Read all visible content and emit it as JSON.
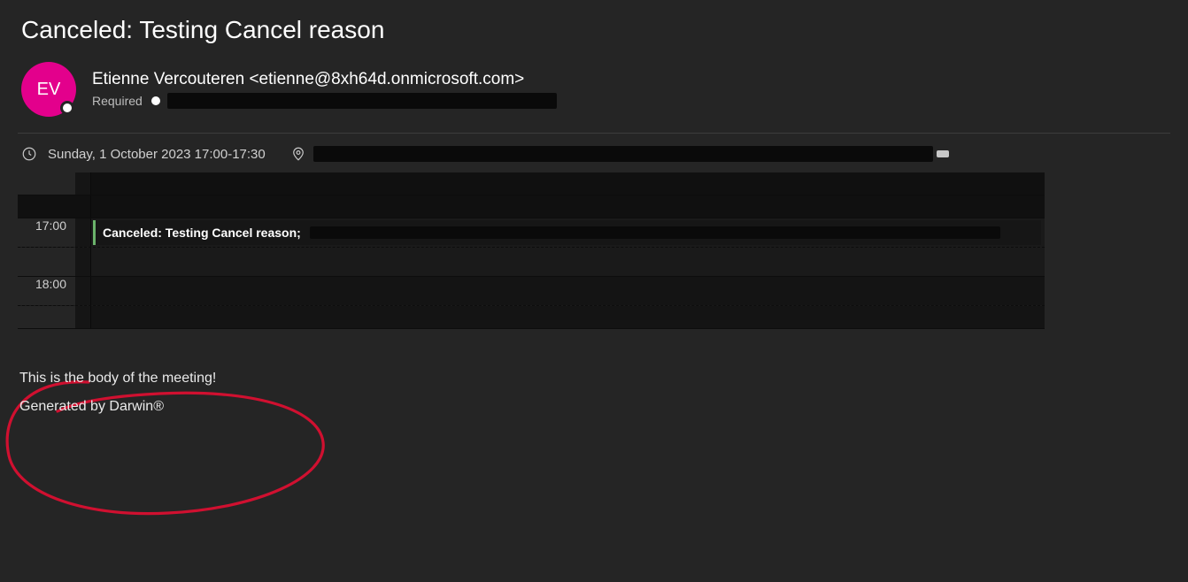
{
  "title": "Canceled: Testing Cancel reason",
  "sender": {
    "initials": "EV",
    "display": "Etienne Vercouteren <etienne@8xh64d.onmicrosoft.com>",
    "attendance_label": "Required"
  },
  "when": {
    "text": "Sunday, 1 October 2023 17:00-17:30"
  },
  "calendar": {
    "hours": {
      "r0": "",
      "r1": "",
      "r2": "17:00",
      "r3": "",
      "r4": "18:00",
      "r5": ""
    },
    "event_title": "Canceled: Testing Cancel reason;"
  },
  "body": {
    "line1": "This is the body of the meeting!",
    "line2": "Generated by Darwin®"
  }
}
